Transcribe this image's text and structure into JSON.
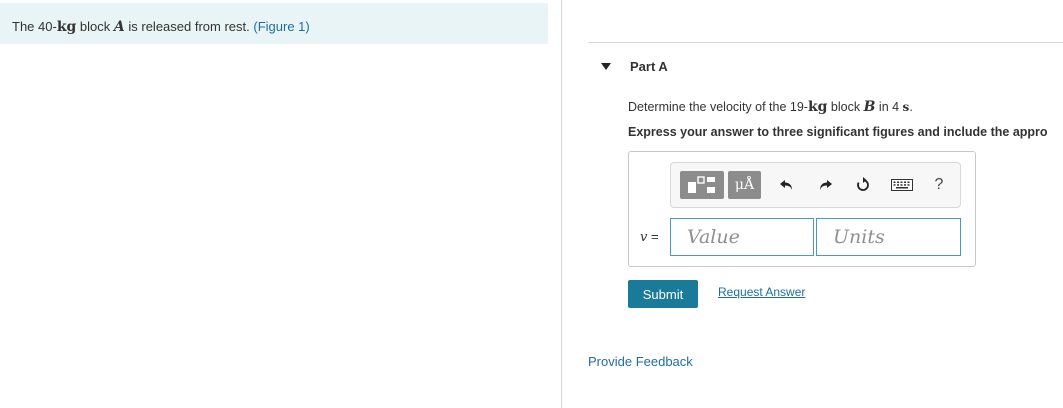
{
  "problem": {
    "text_before_mass": "The 40-",
    "mass_unit": "kg",
    "text_mid": " block ",
    "block_name": "A",
    "text_after": " is released from rest. ",
    "figure_link": "(Figure 1)"
  },
  "part": {
    "title": "Part A",
    "question": {
      "prefix": "Determine the velocity of the 19-",
      "unit": "kg",
      "mid": " block ",
      "block": "B",
      "after": " in 4 ",
      "time_unit": "s",
      "end": "."
    },
    "instruction": "Express your answer to three significant figures and include the appro",
    "toolbar": {
      "icons": [
        "templates-icon",
        "units-symbol-icon",
        "undo-icon",
        "redo-icon",
        "reset-icon",
        "keyboard-icon",
        "help-icon"
      ],
      "units_symbol": "μÅ",
      "help_label": "?"
    },
    "variable": "v",
    "equals": " =",
    "value_placeholder": "Value",
    "units_placeholder": "Units",
    "submit_label": "Submit",
    "request_answer_label": "Request Answer"
  },
  "feedback_label": "Provide Feedback",
  "colors": {
    "problem_bg": "#e9f4f6",
    "link": "#1f6ea3",
    "submit_bg": "#1a7a9a",
    "input_border": "#4a9bb5"
  }
}
